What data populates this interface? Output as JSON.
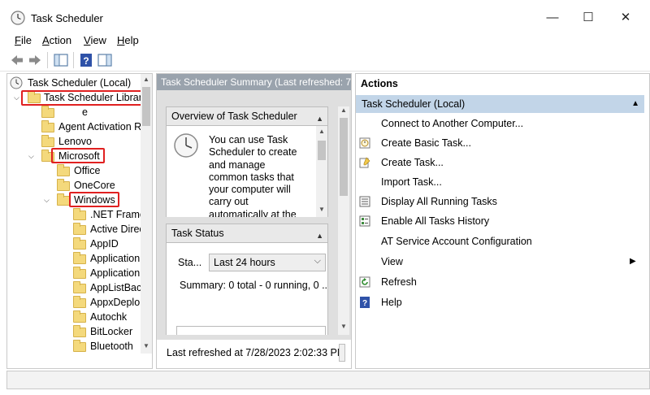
{
  "window": {
    "title": "Task Scheduler",
    "minimize_glyph": "—",
    "maximize_glyph": "☐",
    "close_glyph": "✕"
  },
  "menu": {
    "file": {
      "u": "F",
      "rest": "ile"
    },
    "action": {
      "u": "A",
      "rest": "ction"
    },
    "view": {
      "u": "V",
      "rest": "iew"
    },
    "help": {
      "u": "H",
      "rest": "elp"
    }
  },
  "tree": {
    "root": "Task Scheduler (Local)",
    "library": "Task Scheduler Library",
    "items": [
      "e",
      "Agent Activation R",
      "Lenovo",
      "Microsoft",
      "Office",
      "OneCore",
      "Windows",
      ".NET Frame",
      "Active Direc",
      "AppID",
      "Application",
      "Application",
      "AppListBac",
      "AppxDeplo",
      "Autochk",
      "BitLocker",
      "Bluetooth"
    ]
  },
  "middle": {
    "header": "Task Scheduler Summary (Last refreshed: 7/2",
    "overview_title": "Overview of Task Scheduler",
    "overview_lines": [
      "You can use Task",
      "Scheduler to create",
      "and manage",
      "common tasks that",
      "your computer will",
      "carry out",
      "automatically at the"
    ],
    "status_title": "Task Status",
    "status_label": "Sta...",
    "status_select": "Last 24 hours",
    "summary": "Summary: 0 total - 0 running, 0 ...",
    "last_refreshed": "Last refreshed at 7/28/2023 2:02:33 PM"
  },
  "actions": {
    "title": "Actions",
    "group": "Task Scheduler (Local)",
    "items": [
      {
        "label": "Connect to Another Computer...",
        "icon": "none"
      },
      {
        "label": "Create Basic Task...",
        "icon": "create-basic-task-icon"
      },
      {
        "label": "Create Task...",
        "icon": "create-task-icon"
      },
      {
        "label": "Import Task...",
        "icon": "none"
      },
      {
        "label": "Display All Running Tasks",
        "icon": "running-tasks-icon"
      },
      {
        "label": "Enable All Tasks History",
        "icon": "history-icon"
      },
      {
        "label": "AT Service Account Configuration",
        "icon": "none"
      },
      {
        "label": "View",
        "icon": "none"
      },
      {
        "label": "Refresh",
        "icon": "refresh-icon"
      },
      {
        "label": "Help",
        "icon": "help-icon"
      }
    ]
  },
  "colors": {
    "highlight_box": "#e02020",
    "actions_group_bg": "#c2d5e8",
    "mid_header_bg": "#9aa3ad"
  }
}
